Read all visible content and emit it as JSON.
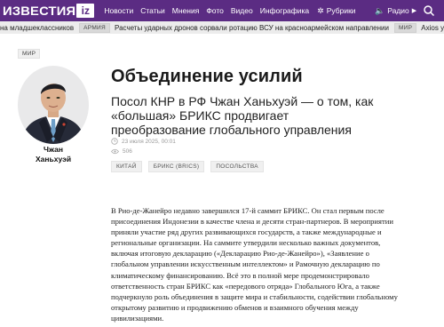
{
  "header": {
    "logo_text": "ИЗВЕСТИЯ",
    "logo_badge": "iz",
    "nav": [
      "Новости",
      "Статьи",
      "Мнения",
      "Фото",
      "Видео",
      "Инфографика"
    ],
    "rubrics_label": "Рубрики",
    "radio_label": "Радио",
    "accent_color": "#5b2c83"
  },
  "ticker": {
    "items": [
      {
        "tag": "",
        "text": "на младшеклассников"
      },
      {
        "tag": "АРМИЯ",
        "text": "Расчеты ударных дронов сорвали ротацию ВСУ на красноармейском направлении"
      },
      {
        "tag": "МИР",
        "text": "Axios узна"
      }
    ]
  },
  "article": {
    "section": "МИР",
    "person_name_line1": "Чжан",
    "person_name_line2": "Ханьхуэй",
    "title": "Объединение усилий",
    "subtitle": "Посол КНР в РФ Чжан Ханьхуэй — о том, как «большая» БРИКС продвигает преобразование глобального управления",
    "date": "23 июля 2025, 00:01",
    "views": "506",
    "tags": [
      "КИТАЙ",
      "БРИКС (BRICS)",
      "ПОСОЛЬСТВА"
    ],
    "body": "В Рио-де-Жанейро недавно завершился 17-й саммит БРИКС. Он стал первым после присоединения Индонезии в качестве члена и десяти стран-партнеров. В мероприятии приняли участие ряд других развивающихся государств, а также международные и региональные организации. На саммите утвердили несколько важных документов, включая итоговую декларацию («Декларацию Рио-де-Жанейро»), «Заявление о глобальном управлении искусственным интеллектом» и Рамочную декларацию по климатическому финансированию. Всё это в полной мере продемонстрировало ответственность стран БРИКС как «передового отряда» Глобального Юга, а также подчеркнуло роль объединения в защите мира и стабильности, содействии глобальному открытому развитию и продвижению обменов и взаимного обучения между цивилизациями."
  }
}
